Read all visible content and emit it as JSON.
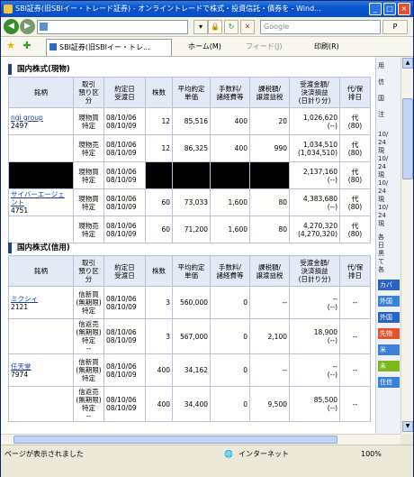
{
  "window": {
    "title": "SBI証券(旧SBIイー・トレード証券) - オンライントレードで株式・投資信託・債券を - Wind...",
    "minimize": "_",
    "maximize": "□",
    "close": "×"
  },
  "addressbar": {
    "url": "",
    "search_placeholder": "Google",
    "search_go": "P"
  },
  "favbar": {
    "tab_label": "SBI証券(旧SBIイー・トレ...",
    "home_label": "ホーム(M)",
    "feed_label": "フィード(J)",
    "print_label": "印刷(R)"
  },
  "genbutsu": {
    "heading": "国内株式(現物)",
    "headers": [
      "銘柄",
      "取引\n預り区分",
      "約定日\n受渡日",
      "株数",
      "平均約定\n単価",
      "手数料/\n諸経費等",
      "課税額/\n譲渡益税",
      "受渡金額/\n決済損益\n(日計り分)",
      "代/保\n排日"
    ],
    "rows": [
      {
        "name": "ngi group",
        "code": "2497",
        "kubun": "現物買\n特定",
        "date": "08/10/06\n08/10/09",
        "shares": "12",
        "price": "85,516",
        "fee": "400",
        "tax": "20",
        "amount": "1,026,620\n(--)",
        "dai": "代\n(80)"
      },
      {
        "name": "",
        "code": "",
        "kubun": "現物売\n特定",
        "date": "08/10/06\n08/10/09",
        "shares": "12",
        "price": "86,325",
        "fee": "400",
        "tax": "990",
        "amount": "1,034,510\n(1,034,510)",
        "dai": "代\n(80)"
      },
      {
        "name": "",
        "code": "",
        "kubun": "現物買\n特定",
        "date": "08/10/06\n08/10/09",
        "shares": "",
        "price": "",
        "fee": "",
        "tax": "",
        "amount": "2,137,160\n(--)",
        "dai": "代\n(80)"
      },
      {
        "name": "サイバーエージェント",
        "code": "4751",
        "kubun": "現物買\n特定",
        "date": "08/10/06\n08/10/09",
        "shares": "60",
        "price": "73,033",
        "fee": "1,600",
        "tax": "80",
        "amount": "4,383,680\n(--)",
        "dai": "代\n(80)"
      },
      {
        "name": "",
        "code": "",
        "kubun": "現物売\n特定",
        "date": "08/10/06\n08/10/09",
        "shares": "60",
        "price": "71,200",
        "fee": "1,600",
        "tax": "80",
        "amount": "4,270,320\n(4,270,320)",
        "dai": "代\n(80)"
      }
    ]
  },
  "shinyo": {
    "heading": "国内株式(信用)",
    "headers": [
      "銘柄",
      "取引\n預り区\n分",
      "約定日\n受渡日",
      "株数",
      "平均約定\n単価",
      "手数料/\n諸経費等",
      "課税額/\n譲渡益税",
      "受渡金額/\n決済損益\n(日計り分)",
      "代/保\n排日"
    ],
    "rows": [
      {
        "name": "ミクシィ",
        "code": "2121",
        "kubun": "信新買\n(無期限)\n特定",
        "date": "08/10/06\n08/10/09",
        "shares": "3",
        "price": "560,000",
        "fee": "0",
        "tax": "--",
        "amount": "--\n(--)",
        "dai": "--"
      },
      {
        "name": "",
        "code": "",
        "kubun": "信返売\n(無期限)\n特定\n--",
        "date": "08/10/06\n08/10/09",
        "shares": "3",
        "price": "567,000",
        "fee": "0",
        "tax": "2,100",
        "amount": "18,900\n(--)",
        "dai": "--"
      },
      {
        "name": "任天堂",
        "code": "7974",
        "kubun": "信新買\n(無期限)\n特定",
        "date": "08/10/06\n08/10/09",
        "shares": "400",
        "price": "34,162",
        "fee": "0",
        "tax": "--",
        "amount": "--\n(--)",
        "dai": "--"
      },
      {
        "name": "",
        "code": "",
        "kubun": "信返売\n(無期限)\n特定\n--",
        "date": "08/10/06\n08/10/09",
        "shares": "400",
        "price": "34,400",
        "fee": "0",
        "tax": "9,500",
        "amount": "85,500\n(--)",
        "dai": "--"
      }
    ]
  },
  "sidebar": {
    "texts": [
      "用",
      "信",
      "国",
      "注"
    ],
    "entries": [
      "10/",
      "24",
      "現",
      "10/",
      "24",
      "現",
      "10/",
      "24",
      "現",
      "10/",
      "24",
      "現"
    ],
    "notes": [
      "各",
      "日",
      "黒",
      "て",
      "各"
    ],
    "badges": [
      {
        "label": "カバ",
        "color": "#2a63c6"
      },
      {
        "label": "外国",
        "color": "#3a82d8"
      },
      {
        "label": "外国",
        "color": "#2a63c6"
      },
      {
        "label": "先物",
        "color": "#e2532e"
      },
      {
        "label": "米",
        "color": "#3a82d8"
      },
      {
        "label": "未",
        "color": "#7ab820"
      },
      {
        "label": "住信",
        "color": "#3a82d8"
      }
    ]
  },
  "statusbar": {
    "message": "ページが表示されました",
    "zone": "インターネット",
    "zoom": "100%"
  }
}
